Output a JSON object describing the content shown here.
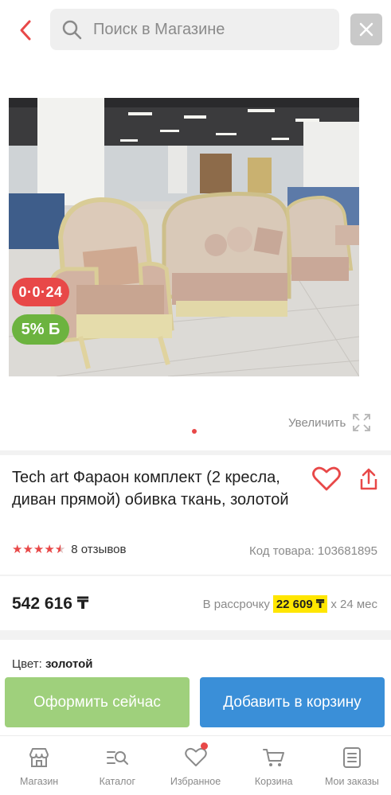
{
  "search": {
    "placeholder": "Поиск в Магазине"
  },
  "gallery": {
    "badge_timer": "0·0·24",
    "badge_bonus": "5% Б",
    "zoom_label": "Увеличить"
  },
  "product": {
    "title": "Tech art Фараон комплект (2 кресла, диван прямой) обивка ткань, золотой",
    "rating": 4.5,
    "reviews": "8 отзывов",
    "sku": "Код товара: 103681895"
  },
  "price": {
    "value": "542 616 ₸",
    "installment_prefix": "В рассрочку",
    "installment_amount": "22 609 ₸",
    "installment_suffix": "х 24 мес"
  },
  "color": {
    "label": "Цвет:",
    "value": "золотой"
  },
  "actions": {
    "buy_now": "Оформить сейчас",
    "add_to_cart": "Добавить в корзину"
  },
  "tabs": [
    {
      "label": "Магазин",
      "icon": "shop-icon"
    },
    {
      "label": "Каталог",
      "icon": "catalog-search-icon"
    },
    {
      "label": "Избранное",
      "icon": "heart-icon"
    },
    {
      "label": "Корзина",
      "icon": "cart-icon"
    },
    {
      "label": "Мои заказы",
      "icon": "orders-icon"
    }
  ],
  "colors": {
    "accent_red": "#e84848",
    "bonus_green": "#6cb33f",
    "buy_now_green": "#9fd07c",
    "cart_blue": "#3a8fd8",
    "installment_yellow": "#ffe600"
  }
}
